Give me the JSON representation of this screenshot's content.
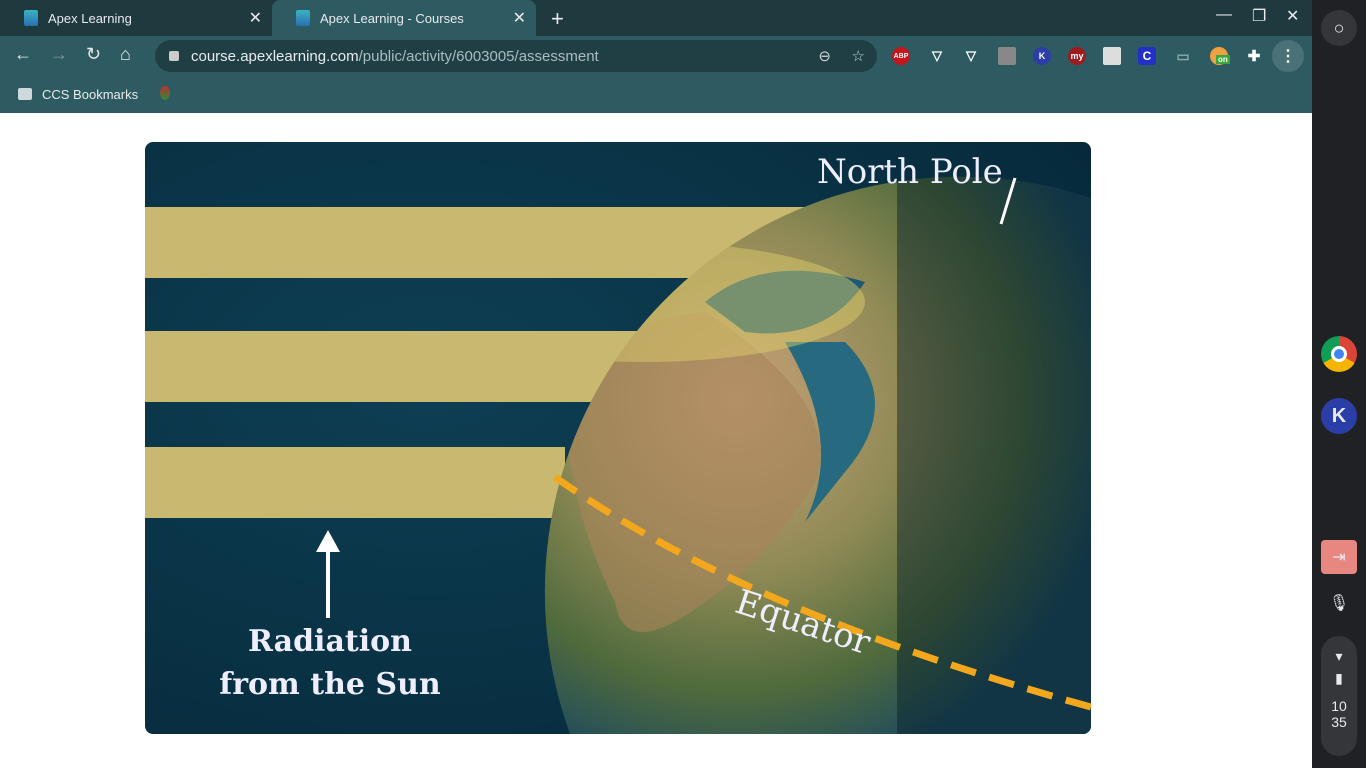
{
  "tabs": [
    {
      "label": "Apex Learning",
      "active": false
    },
    {
      "label": "Apex Learning - Courses",
      "active": true
    }
  ],
  "address": {
    "domain": "course.apexlearning.com",
    "path": "/public/activity/6003005/assessment"
  },
  "bookmarks": [
    {
      "label": "CCS Bookmarks"
    }
  ],
  "extensions": [
    {
      "name": "adblock-plus",
      "label": "ABP",
      "color": "#c4161c"
    },
    {
      "name": "kami",
      "label": "K",
      "color": "#2b3ea8"
    },
    {
      "name": "my",
      "label": "my",
      "color": "#9e1b20"
    },
    {
      "name": "c-ext",
      "label": "C",
      "color": "#2230c8"
    },
    {
      "name": "on-ext",
      "label": "on",
      "color": "#3aa53a"
    }
  ],
  "figure": {
    "labels": {
      "north_pole": "North Pole",
      "equator": "Equator",
      "radiation_line1": "Radiation",
      "radiation_line2": "from the Sun"
    }
  },
  "shelf": {
    "time_hour": "10",
    "time_min": "35"
  }
}
